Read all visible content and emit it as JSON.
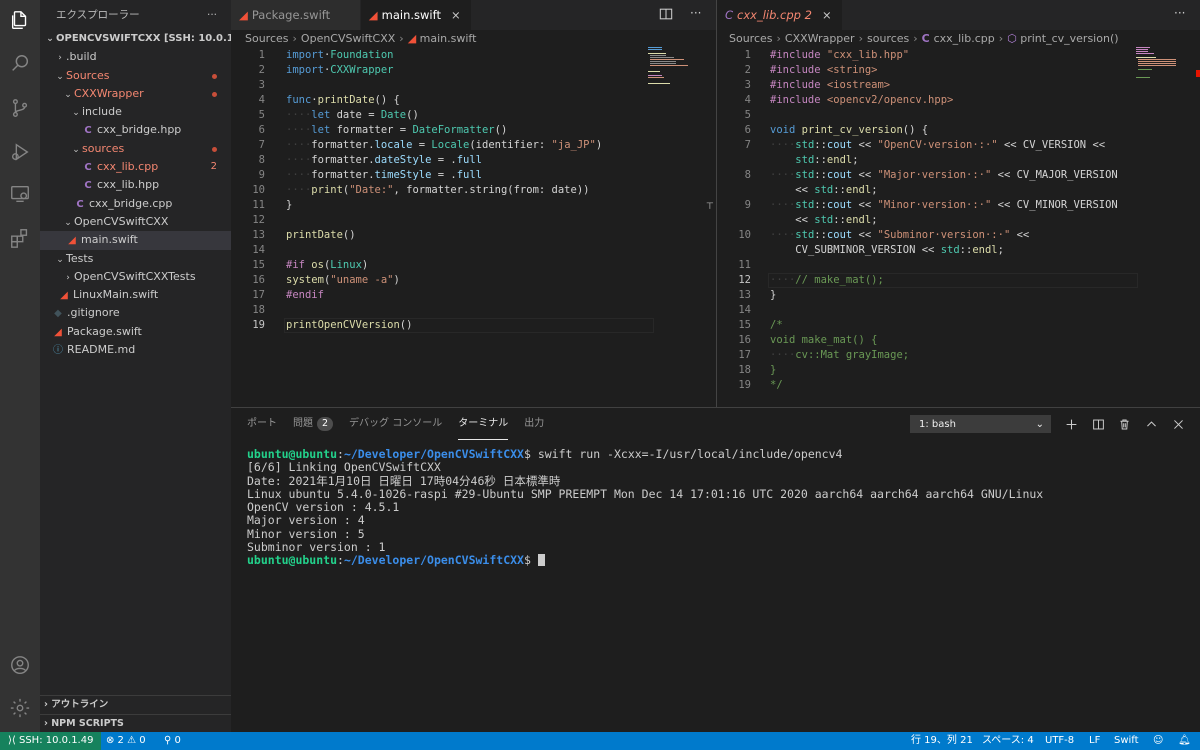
{
  "sidebar": {
    "title": "エクスプローラー",
    "more": "···",
    "tree": [
      {
        "label": "OPENCVSWIFTCXX [SSH: 10.0.1.49]",
        "chev": "⌄",
        "icon": "",
        "indent": 4,
        "cls": "root",
        "name": "workspace-root"
      },
      {
        "label": ".build",
        "chev": "›",
        "icon": "",
        "indent": 14,
        "cls": "",
        "name": "folder-build"
      },
      {
        "label": "Sources",
        "chev": "⌄",
        "icon": "",
        "indent": 14,
        "cls": "mod",
        "dot": true,
        "name": "folder-sources"
      },
      {
        "label": "CXXWrapper",
        "chev": "⌄",
        "icon": "",
        "indent": 22,
        "cls": "mod",
        "dot": true,
        "name": "folder-cxxwrapper"
      },
      {
        "label": "include",
        "chev": "⌄",
        "icon": "",
        "indent": 30,
        "cls": "",
        "name": "folder-include"
      },
      {
        "label": "cxx_bridge.hpp",
        "chev": "",
        "icon": "C",
        "iconcls": "cpp-ic",
        "indent": 42,
        "cls": "",
        "name": "file-cxx-bridge-hpp"
      },
      {
        "label": "sources",
        "chev": "⌄",
        "icon": "",
        "indent": 30,
        "cls": "mod",
        "dot": true,
        "name": "folder-sources-lower"
      },
      {
        "label": "cxx_lib.cpp",
        "chev": "",
        "icon": "C",
        "iconcls": "cpp-ic",
        "indent": 42,
        "cls": "mod",
        "count": "2",
        "name": "file-cxx-lib-cpp"
      },
      {
        "label": "cxx_lib.hpp",
        "chev": "",
        "icon": "C",
        "iconcls": "cpp-ic",
        "indent": 42,
        "cls": "",
        "name": "file-cxx-lib-hpp"
      },
      {
        "label": "cxx_bridge.cpp",
        "chev": "",
        "icon": "C",
        "iconcls": "cpp-ic",
        "indent": 34,
        "cls": "",
        "name": "file-cxx-bridge-cpp"
      },
      {
        "label": "OpenCVSwiftCXX",
        "chev": "⌄",
        "icon": "",
        "indent": 22,
        "cls": "",
        "name": "folder-opencvswiftcxx"
      },
      {
        "label": "main.swift",
        "chev": "",
        "icon": "◢",
        "iconcls": "swift-ic",
        "indent": 26,
        "cls": "selected",
        "name": "file-main-swift"
      },
      {
        "label": "Tests",
        "chev": "⌄",
        "icon": "",
        "indent": 14,
        "cls": "",
        "name": "folder-tests"
      },
      {
        "label": "OpenCVSwiftCXXTests",
        "chev": "›",
        "icon": "",
        "indent": 22,
        "cls": "",
        "name": "folder-tests-sub"
      },
      {
        "label": "LinuxMain.swift",
        "chev": "",
        "icon": "◢",
        "iconcls": "swift-ic",
        "indent": 18,
        "cls": "",
        "name": "file-linuxmain-swift"
      },
      {
        "label": ".gitignore",
        "chev": "",
        "icon": "◆",
        "iconcls": "git-ic",
        "indent": 12,
        "cls": "",
        "name": "file-gitignore"
      },
      {
        "label": "Package.swift",
        "chev": "",
        "icon": "◢",
        "iconcls": "swift-ic",
        "indent": 12,
        "cls": "",
        "name": "file-package-swift"
      },
      {
        "label": "README.md",
        "chev": "",
        "icon": "ⓘ",
        "iconcls": "info-ic",
        "indent": 12,
        "cls": "",
        "name": "file-readme"
      }
    ],
    "outline": "アウトライン",
    "npm": "NPM SCRIPTS"
  },
  "editor_left": {
    "tabs": [
      {
        "label": "Package.swift",
        "active": false
      },
      {
        "label": "main.swift",
        "active": true
      }
    ],
    "close": "×",
    "breadcrumb": [
      "Sources",
      "OpenCVSwiftCXX",
      "main.swift"
    ],
    "current_line": 19,
    "lines": [
      [
        [
          "kw",
          "import"
        ],
        [
          "",
          "·"
        ],
        [
          "ty",
          "Foundation"
        ]
      ],
      [
        [
          "kw",
          "import"
        ],
        [
          "",
          "·"
        ],
        [
          "ty",
          "CXXWrapper"
        ]
      ],
      [],
      [
        [
          "kw",
          "func"
        ],
        [
          "",
          "·"
        ],
        [
          "fn",
          "printDate"
        ],
        [
          "",
          "() {"
        ]
      ],
      [
        [
          "ws",
          "····"
        ],
        [
          "kw",
          "let"
        ],
        [
          "",
          " date = "
        ],
        [
          "ty",
          "Date"
        ],
        [
          "",
          "()"
        ]
      ],
      [
        [
          "ws",
          "····"
        ],
        [
          "kw",
          "let"
        ],
        [
          "",
          " formatter = "
        ],
        [
          "ty",
          "DateFormatter"
        ],
        [
          "",
          "()"
        ]
      ],
      [
        [
          "ws",
          "····"
        ],
        [
          "",
          "formatter."
        ],
        [
          "pr",
          "locale"
        ],
        [
          "",
          " = "
        ],
        [
          "ty",
          "Locale"
        ],
        [
          "",
          "(identifier: "
        ],
        [
          "st",
          "\"ja_JP\""
        ],
        [
          "",
          ")"
        ]
      ],
      [
        [
          "ws",
          "····"
        ],
        [
          "",
          "formatter."
        ],
        [
          "pr",
          "dateStyle"
        ],
        [
          "",
          " = ."
        ],
        [
          "pr",
          "full"
        ]
      ],
      [
        [
          "ws",
          "····"
        ],
        [
          "",
          "formatter."
        ],
        [
          "pr",
          "timeStyle"
        ],
        [
          "",
          " = ."
        ],
        [
          "pr",
          "full"
        ]
      ],
      [
        [
          "ws",
          "····"
        ],
        [
          "fn",
          "print"
        ],
        [
          "",
          "("
        ],
        [
          "st",
          "\"Date:\""
        ],
        [
          "",
          ", formatter.string(from: date))"
        ]
      ],
      [
        [
          "",
          "}"
        ]
      ],
      [],
      [
        [
          "fn",
          "printDate"
        ],
        [
          "",
          "()"
        ]
      ],
      [],
      [
        [
          "pp",
          "#if"
        ],
        [
          "",
          " "
        ],
        [
          "fn",
          "os"
        ],
        [
          "",
          "("
        ],
        [
          "ty",
          "Linux"
        ],
        [
          "",
          ")"
        ]
      ],
      [
        [
          "fn",
          "system"
        ],
        [
          "",
          "("
        ],
        [
          "st",
          "\"uname -a\""
        ],
        [
          "",
          ")"
        ]
      ],
      [
        [
          "pp",
          "#endif"
        ]
      ],
      [],
      [
        [
          "fn",
          "printOpenCVVersion"
        ],
        [
          "",
          "()"
        ]
      ]
    ]
  },
  "editor_right": {
    "tab": {
      "label": "cxx_lib.cpp",
      "problems": "2"
    },
    "breadcrumb": [
      "Sources",
      "CXXWrapper",
      "sources",
      "cxx_lib.cpp",
      "print_cv_version()"
    ],
    "current_line": 12,
    "lines": [
      {
        "n": "1",
        "segs": [
          [
            "pp",
            "#include"
          ],
          [
            "",
            " "
          ],
          [
            "st",
            "\"cxx_lib.hpp\""
          ]
        ]
      },
      {
        "n": "2",
        "segs": [
          [
            "pp",
            "#include"
          ],
          [
            "",
            " "
          ],
          [
            "st",
            "<string>"
          ]
        ]
      },
      {
        "n": "3",
        "segs": [
          [
            "pp",
            "#include"
          ],
          [
            "",
            " "
          ],
          [
            "st",
            "<iostream>"
          ]
        ]
      },
      {
        "n": "4",
        "segs": [
          [
            "pp",
            "#include"
          ],
          [
            "",
            " "
          ],
          [
            "st",
            "<opencv2/opencv.hpp>"
          ]
        ]
      },
      {
        "n": "5",
        "segs": []
      },
      {
        "n": "6",
        "segs": [
          [
            "kw",
            "void"
          ],
          [
            "",
            " "
          ],
          [
            "fn",
            "print_cv_version"
          ],
          [
            "",
            "() {"
          ]
        ]
      },
      {
        "n": "7",
        "segs": [
          [
            "ws",
            "····"
          ],
          [
            "ty",
            "std"
          ],
          [
            "",
            "::"
          ],
          [
            "pr",
            "cout"
          ],
          [
            "",
            " << "
          ],
          [
            "st",
            "\"OpenCV·version·:·\""
          ],
          [
            "",
            " << CV_VERSION <<"
          ]
        ]
      },
      {
        "n": "",
        "segs": [
          [
            "",
            "    "
          ],
          [
            "ty",
            "std"
          ],
          [
            "",
            "::"
          ],
          [
            "fn",
            "endl"
          ],
          [
            "",
            ";"
          ]
        ]
      },
      {
        "n": "8",
        "segs": [
          [
            "ws",
            "····"
          ],
          [
            "ty",
            "std"
          ],
          [
            "",
            "::"
          ],
          [
            "pr",
            "cout"
          ],
          [
            "",
            " << "
          ],
          [
            "st",
            "\"Major·version·:·\""
          ],
          [
            "",
            " << CV_MAJOR_VERSION"
          ]
        ]
      },
      {
        "n": "",
        "segs": [
          [
            "",
            "    << "
          ],
          [
            "ty",
            "std"
          ],
          [
            "",
            "::"
          ],
          [
            "fn",
            "endl"
          ],
          [
            "",
            ";"
          ]
        ]
      },
      {
        "n": "9",
        "segs": [
          [
            "ws",
            "····"
          ],
          [
            "ty",
            "std"
          ],
          [
            "",
            "::"
          ],
          [
            "pr",
            "cout"
          ],
          [
            "",
            " << "
          ],
          [
            "st",
            "\"Minor·version·:·\""
          ],
          [
            "",
            " << CV_MINOR_VERSION"
          ]
        ]
      },
      {
        "n": "",
        "segs": [
          [
            "",
            "    << "
          ],
          [
            "ty",
            "std"
          ],
          [
            "",
            "::"
          ],
          [
            "fn",
            "endl"
          ],
          [
            "",
            ";"
          ]
        ]
      },
      {
        "n": "10",
        "segs": [
          [
            "ws",
            "····"
          ],
          [
            "ty",
            "std"
          ],
          [
            "",
            "::"
          ],
          [
            "pr",
            "cout"
          ],
          [
            "",
            " << "
          ],
          [
            "st",
            "\"Subminor·version·:·\""
          ],
          [
            "",
            " <<"
          ]
        ]
      },
      {
        "n": "",
        "segs": [
          [
            "",
            "    CV_SUBMINOR_VERSION << "
          ],
          [
            "ty",
            "std"
          ],
          [
            "",
            "::"
          ],
          [
            "fn",
            "endl"
          ],
          [
            "",
            ";"
          ]
        ]
      },
      {
        "n": "11",
        "segs": []
      },
      {
        "n": "12",
        "segs": [
          [
            "ws",
            "····"
          ],
          [
            "cm",
            "// make_mat();"
          ]
        ]
      },
      {
        "n": "13",
        "segs": [
          [
            "",
            "}"
          ]
        ]
      },
      {
        "n": "14",
        "segs": []
      },
      {
        "n": "15",
        "segs": [
          [
            "cm",
            "/*"
          ]
        ]
      },
      {
        "n": "16",
        "segs": [
          [
            "cm",
            "void make_mat() {"
          ]
        ]
      },
      {
        "n": "17",
        "segs": [
          [
            "ws",
            "····"
          ],
          [
            "cm",
            "cv::Mat grayImage;"
          ]
        ]
      },
      {
        "n": "18",
        "segs": [
          [
            "cm",
            "}"
          ]
        ]
      },
      {
        "n": "19",
        "segs": [
          [
            "cm",
            "*/"
          ]
        ]
      }
    ]
  },
  "panel": {
    "tabs": [
      {
        "label": "ポート",
        "active": false
      },
      {
        "label": "問題",
        "badge": "2",
        "active": false
      },
      {
        "label": "デバッグ コンソール",
        "active": false
      },
      {
        "label": "ターミナル",
        "active": true
      },
      {
        "label": "出力",
        "active": false
      }
    ],
    "terminal_select": "1: bash",
    "terminal": {
      "prompt_user": "ubuntu@ubuntu",
      "prompt_path": "~/Developer/OpenCVSwiftCXX",
      "command": "$ swift run -Xcxx=-I/usr/local/include/opencv4",
      "output": [
        "[6/6] Linking OpenCVSwiftCXX",
        "Date: 2021年1月10日 日曜日 17時04分46秒 日本標準時",
        "Linux ubuntu 5.4.0-1026-raspi #29-Ubuntu SMP PREEMPT Mon Dec 14 17:01:16 UTC 2020 aarch64 aarch64 aarch64 GNU/Linux",
        "OpenCV version : 4.5.1",
        "Major version : 4",
        "Minor version : 5",
        "Subminor version : 1"
      ],
      "final_prompt_suffix": "$ "
    }
  },
  "status": {
    "remote": "SSH: 10.0.1.49",
    "problems": "⊗ 2 ⚠ 0",
    "ports": "⚲ 0",
    "position": "行 19、列 21",
    "spaces": "スペース: 4",
    "encoding": "UTF-8",
    "eol": "LF",
    "language": "Swift"
  },
  "colors": {
    "activity_bar": "#333333",
    "sidebar": "#252526",
    "editor": "#1e1e1e",
    "status_bar": "#007acc",
    "remote": "#16825d",
    "modified": "#f48771"
  }
}
